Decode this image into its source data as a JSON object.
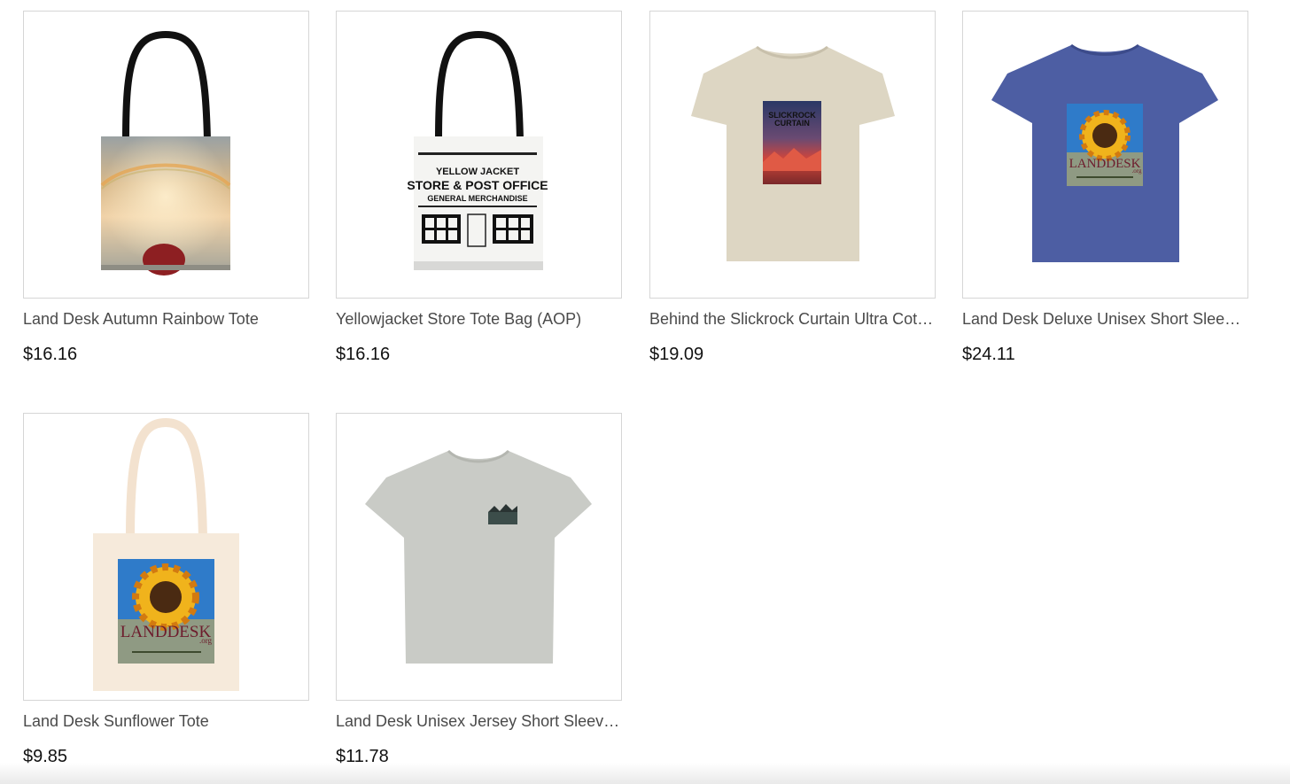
{
  "products": [
    {
      "name": "Land Desk Autumn Rainbow Tote",
      "price": "$16.16",
      "image": "rainbow-tote-image"
    },
    {
      "name": "Yellowjacket Store Tote Bag (AOP)",
      "price": "$16.16",
      "image": "yellowjacket-tote-image",
      "art_text": [
        "YELLOW JACKET",
        "STORE & POST OFFICE",
        "GENERAL MERCHANDISE"
      ]
    },
    {
      "name": "Behind the Slickrock Curtain Ultra Cotton Tee",
      "price": "$19.09",
      "image": "slickrock-tee-image",
      "art_text": [
        "SLICKROCK",
        "CURTAIN"
      ]
    },
    {
      "name": "Land Desk Deluxe Unisex Short Sleeve Tee",
      "price": "$24.11",
      "image": "sunflower-blue-tee-image",
      "art_text": [
        "LANDDESK",
        ".org"
      ]
    },
    {
      "name": "Land Desk Sunflower Tote",
      "price": "$9.85",
      "image": "sunflower-tote-image",
      "art_text": [
        "LANDDESK",
        ".org"
      ]
    },
    {
      "name": "Land Desk Unisex Jersey Short Sleeve Tee",
      "price": "$11.78",
      "image": "gray-jersey-tee-image"
    }
  ],
  "colors": {
    "card_border": "#d6d6d6",
    "name_text": "#4a4a4a",
    "price_text": "#111111",
    "tee_sand": "#ddd6c3",
    "tee_blue": "#4d5ea3",
    "tee_gray": "#c9cbc6",
    "tote_canvas": "#f6eadb"
  }
}
